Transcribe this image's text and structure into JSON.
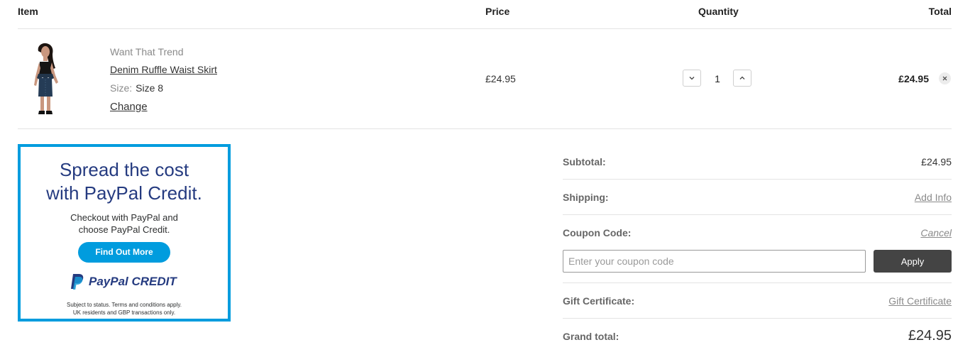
{
  "columns": {
    "item": "Item",
    "price": "Price",
    "quantity": "Quantity",
    "total": "Total"
  },
  "cart_item": {
    "brand": "Want That Trend",
    "name": "Denim Ruffle Waist Skirt",
    "size_label": "Size:",
    "size_value": "Size 8",
    "change_label": "Change",
    "price": "£24.95",
    "quantity": "1",
    "total": "£24.95"
  },
  "promo": {
    "headline_line1": "Spread the cost",
    "headline_line2": "with PayPal Credit.",
    "sub_line1": "Checkout with PayPal and",
    "sub_line2": "choose PayPal Credit.",
    "button_label": "Find Out More",
    "logo_paypal": "PayPal",
    "logo_credit": "CREDIT",
    "fine_line1": "Subject to status. Terms and conditions apply.",
    "fine_line2": "UK residents and GBP transactions only.",
    "border_color": "#009cde",
    "text_color": "#253b80"
  },
  "summary": {
    "subtotal_label": "Subtotal:",
    "subtotal_value": "£24.95",
    "shipping_label": "Shipping:",
    "shipping_link": "Add Info",
    "coupon_label": "Coupon Code:",
    "coupon_cancel": "Cancel",
    "coupon_placeholder": "Enter your coupon code",
    "apply_label": "Apply",
    "gift_label": "Gift Certificate:",
    "gift_link": "Gift Certificate",
    "grand_label": "Grand total:",
    "grand_value": "£24.95"
  },
  "icons": {
    "decrease": "chevron-down-icon",
    "increase": "chevron-up-icon",
    "remove": "close-icon"
  }
}
